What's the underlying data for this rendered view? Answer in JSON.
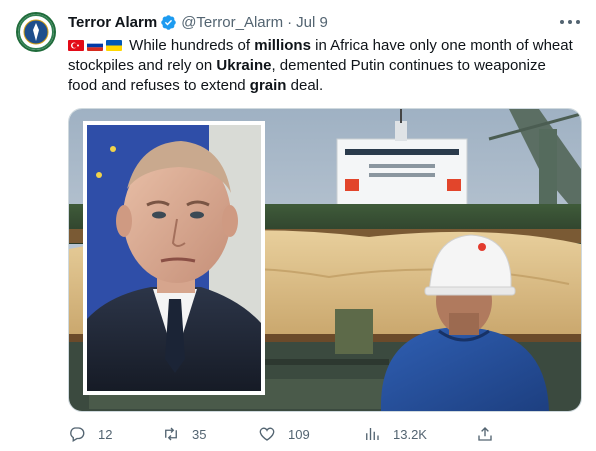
{
  "tweet": {
    "author_name": "Terror Alarm",
    "handle": "@Terror_Alarm",
    "separator": "·",
    "date": "Jul 9",
    "avatar_icon": "terror-alarm-logo",
    "verified_icon": "verified-badge-icon",
    "verified_color": "#1d9bf0",
    "flags": [
      "turkey-flag-icon",
      "russia-flag-icon",
      "ukraine-flag-icon"
    ],
    "text": {
      "p1": " While hundreds of ",
      "b1": "millions",
      "p2": " in Africa have only one month of wheat stockpiles and rely on ",
      "b2": "Ukraine",
      "p3": ", demented Putin continues to weaponize food and refuses to extend ",
      "b3": "grain",
      "p4": " deal."
    }
  },
  "actions": {
    "replies": "12",
    "retweets": "35",
    "likes": "109",
    "views": "13.2K"
  }
}
